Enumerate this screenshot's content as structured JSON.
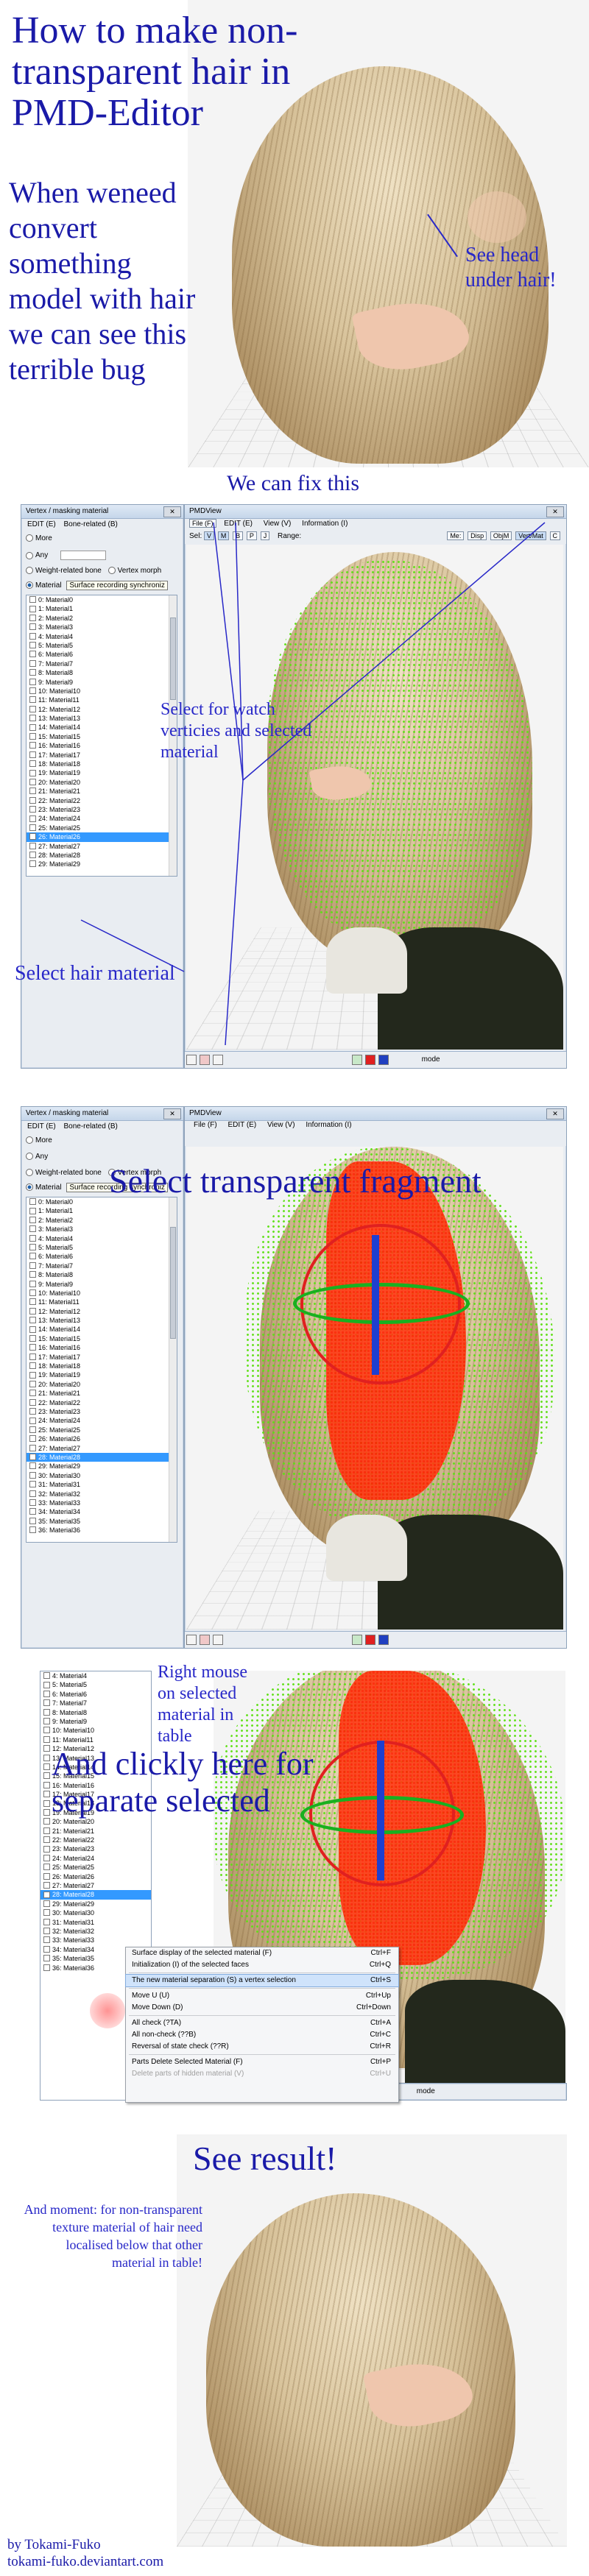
{
  "panel1": {
    "title": "How to make non-transparent hair in PMD-Editor",
    "intro": "When weneed convert something model with hair we can see this terrible bug",
    "note": "See head under hair!"
  },
  "panel2": {
    "caption": "We can fix this",
    "vm_window": {
      "title": "Vertex / masking material",
      "menu": [
        "EDIT (E)",
        "Bone-related (B)"
      ],
      "opts": [
        "More",
        "Any",
        "Weight-related bone",
        "Material"
      ],
      "vertex_morph": "Vertex morph",
      "tooltip": "Surface recording synchroniz",
      "materials": [
        "0: Material0",
        "1: Material1",
        "2: Material2",
        "3: Material3",
        "4: Material4",
        "5: Material5",
        "6: Material6",
        "7: Material7",
        "8: Material8",
        "9: Material9",
        "10: Material10",
        "11: Material11",
        "12: Material12",
        "13: Material13",
        "14: Material14",
        "15: Material15",
        "16: Material16",
        "17: Material17",
        "18: Material18",
        "19: Material19",
        "20: Material20",
        "21: Material21",
        "22: Material22",
        "23: Material23",
        "24: Material24",
        "25: Material25",
        "26: Material26",
        "27: Material27",
        "28: Material28",
        "29: Material29"
      ],
      "selected_index": 26
    },
    "pmd_window": {
      "title": "PMDView",
      "menu": [
        "File (F)",
        "EDIT (E)",
        "View (V)",
        "Information (I)"
      ],
      "sel_label": "Sel:",
      "sel_buttons": [
        "V",
        "M",
        "B",
        "P",
        "J"
      ],
      "range_label": "Range:",
      "mode_buttons": [
        "Me:",
        "Disp",
        "ObjM",
        "Vert/Mat",
        "C"
      ],
      "mode_label": "mode"
    },
    "annotation_watch": "Select for watch verticies and selected material",
    "annotation_hair": "Select hair material"
  },
  "panel3": {
    "caption": "Select transparent fragment",
    "vm_window": {
      "title": "Vertex / masking material",
      "menu": [
        "EDIT (E)",
        "Bone-related (B)"
      ],
      "opts": [
        "More",
        "Any",
        "Weight-related bone",
        "Material"
      ],
      "vertex_morph": "Vertex morph",
      "tooltip": "Surface recording synchroniz",
      "materials": [
        "0: Material0",
        "1: Material1",
        "2: Material2",
        "3: Material3",
        "4: Material4",
        "5: Material5",
        "6: Material6",
        "7: Material7",
        "8: Material8",
        "9: Material9",
        "10: Material10",
        "11: Material11",
        "12: Material12",
        "13: Material13",
        "14: Material14",
        "15: Material15",
        "16: Material16",
        "17: Material17",
        "18: Material18",
        "19: Material19",
        "20: Material20",
        "21: Material21",
        "22: Material22",
        "23: Material23",
        "24: Material24",
        "25: Material25",
        "26: Material26",
        "27: Material27",
        "28: Material28",
        "29: Material29",
        "30: Material30",
        "31: Material31",
        "32: Material32",
        "33: Material33",
        "34: Material34",
        "35: Material35",
        "36: Material36"
      ],
      "selected_index": 28
    },
    "pmd_window": {
      "title": "PMDView",
      "menu": [
        "File (F)",
        "EDIT (E)",
        "View (V)",
        "Information (I)"
      ]
    }
  },
  "panel4": {
    "annotation_right": "Right mouse on selected material in table",
    "caption": "And clickly here for separate selected",
    "materials": [
      "4: Material4",
      "5: Material5",
      "6: Material6",
      "7: Material7",
      "8: Material8",
      "9: Material9",
      "10: Material10",
      "11: Material11",
      "12: Material12",
      "13: Material13",
      "14: Material14",
      "15: Material15",
      "16: Material16",
      "17: Material17",
      "18: Material18",
      "19: Material19",
      "20: Material20",
      "21: Material21",
      "22: Material22",
      "23: Material23",
      "24: Material24",
      "25: Material25",
      "26: Material26",
      "27: Material27",
      "28: Material28",
      "29: Material29",
      "30: Material30",
      "31: Material31",
      "32: Material32",
      "33: Material33",
      "34: Material34",
      "35: Material35",
      "36: Material36"
    ],
    "selected_index": 24,
    "context_menu": [
      {
        "label": "Surface display of the selected material (F)",
        "key": "Ctrl+F"
      },
      {
        "label": "Initialization (I) of the selected faces",
        "key": "Ctrl+Q"
      },
      {
        "label": "The new material separation (S) a vertex selection",
        "key": "Ctrl+S"
      },
      {
        "label": "Move U (U)",
        "key": "Ctrl+Up"
      },
      {
        "label": "Move Down (D)",
        "key": "Ctrl+Down"
      },
      {
        "label": "All check (?TA)",
        "key": "Ctrl+A"
      },
      {
        "label": "All non-check (??B)",
        "key": "Ctrl+C"
      },
      {
        "label": "Reversal of state check (??R)",
        "key": "Ctrl+R"
      },
      {
        "label": "Parts Delete Selected Material (F)",
        "key": "Ctrl+P"
      },
      {
        "label": "Delete parts of hidden material (V)",
        "key": "Ctrl+U"
      }
    ],
    "mode_label": "mode"
  },
  "panel5": {
    "caption": "See result!",
    "moment": "And moment: for non-transparent texture material of hair need localised below that other material in table!"
  },
  "credits": {
    "line1": "by Tokami-Fuko",
    "line2": "tokami-fuko.deviantart.com"
  },
  "colors": {
    "title_blue": "#1a1aa8",
    "vertex_green": "#5fe016",
    "selected_red": "#ff3a14",
    "list_select": "#3399ff"
  }
}
